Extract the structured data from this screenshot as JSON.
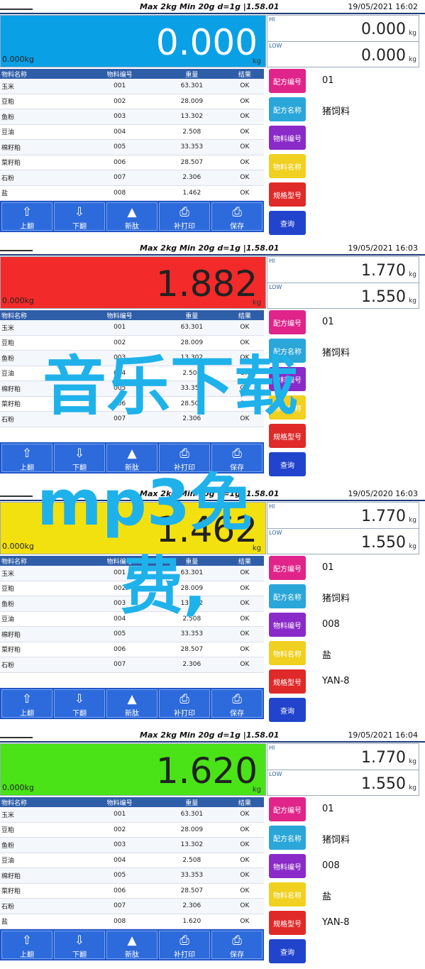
{
  "panels": [
    {
      "header": {
        "status": "Max 2kg  Min 20g  d=1g  |1.58.01",
        "datetime": "19/05/2021 16:02"
      },
      "display": {
        "weight": "0.000",
        "unit": "kg",
        "zero_label": "0.000kg",
        "color": "#0aa0e6",
        "light_text": true
      },
      "hilo": {
        "hi_label": "HI",
        "hi": "0.000",
        "lo_label": "LOW",
        "lo": "0.000",
        "unit": "kg"
      },
      "table": {
        "headers": [
          "物料名称",
          "物料编号",
          "重量",
          "结果"
        ],
        "rows": [
          [
            "玉米",
            "001",
            "63.301",
            "OK"
          ],
          [
            "豆粕",
            "002",
            "28.009",
            "OK"
          ],
          [
            "鱼粉",
            "003",
            "13.302",
            "OK"
          ],
          [
            "豆油",
            "004",
            "2.508",
            "OK"
          ],
          [
            "棉籽粕",
            "005",
            "33.353",
            "OK"
          ],
          [
            "菜籽粕",
            "006",
            "28.507",
            "OK"
          ],
          [
            "石粉",
            "007",
            "2.306",
            "OK"
          ],
          [
            "盐",
            "008",
            "1.462",
            "OK"
          ]
        ]
      },
      "side": [
        {
          "label": "配方编号",
          "value": "01"
        },
        {
          "label": "配方名称",
          "value": "猪饲料"
        },
        {
          "label": "物料编号",
          "value": ""
        },
        {
          "label": "物料名称",
          "value": ""
        },
        {
          "label": "规格型号",
          "value": ""
        },
        {
          "label": "查询",
          "value": ""
        }
      ],
      "bottom": [
        "上翻",
        "下翻",
        "新肽",
        "补打印",
        "保存"
      ]
    },
    {
      "header": {
        "status": "Max 2kg  Min 20g  d=1g  |1.58.01",
        "datetime": "19/05/2021 16:03"
      },
      "display": {
        "weight": "1.882",
        "unit": "kg",
        "zero_label": "0.000kg",
        "color": "#f22a2a",
        "light_text": false
      },
      "hilo": {
        "hi_label": "HI",
        "hi": "1.770",
        "lo_label": "LOW",
        "lo": "1.550",
        "unit": "kg"
      },
      "table": {
        "headers": [
          "物料名称",
          "物料编号",
          "重量",
          "结果"
        ],
        "rows": [
          [
            "玉米",
            "001",
            "63.301",
            "OK"
          ],
          [
            "豆粕",
            "002",
            "28.009",
            "OK"
          ],
          [
            "鱼粉",
            "003",
            "13.302",
            "OK"
          ],
          [
            "豆油",
            "004",
            "2.508",
            "OK"
          ],
          [
            "棉籽粕",
            "005",
            "33.353",
            "OK"
          ],
          [
            "菜籽粕",
            "006",
            "28.507",
            "OK"
          ],
          [
            "石粉",
            "007",
            "2.306",
            "OK"
          ]
        ]
      },
      "side": [
        {
          "label": "配方编号",
          "value": "01"
        },
        {
          "label": "配方名称",
          "value": "猪饲料"
        },
        {
          "label": "物料编号",
          "value": ""
        },
        {
          "label": "物料名称",
          "value": ""
        },
        {
          "label": "规格型号",
          "value": ""
        },
        {
          "label": "查询",
          "value": ""
        }
      ],
      "bottom": [
        "上翻",
        "下翻",
        "新肽",
        "补打印",
        "保存"
      ]
    },
    {
      "header": {
        "status": "Max 2kg  Min 20g  d=1g  |1.58.01",
        "datetime": "19/05/2020 16:03"
      },
      "display": {
        "weight": "1.462",
        "unit": "kg",
        "zero_label": "0.000kg",
        "color": "#f3e10f",
        "light_text": false
      },
      "hilo": {
        "hi_label": "HI",
        "hi": "1.770",
        "lo_label": "LOW",
        "lo": "1.550",
        "unit": "kg"
      },
      "table": {
        "headers": [
          "物料名称",
          "物料编号",
          "重量",
          "结果"
        ],
        "rows": [
          [
            "玉米",
            "001",
            "63.301",
            "OK"
          ],
          [
            "豆粕",
            "002",
            "28.009",
            "OK"
          ],
          [
            "鱼粉",
            "003",
            "13.302",
            "OK"
          ],
          [
            "豆油",
            "004",
            "2.508",
            "OK"
          ],
          [
            "棉籽粕",
            "005",
            "33.353",
            "OK"
          ],
          [
            "菜籽粕",
            "006",
            "28.507",
            "OK"
          ],
          [
            "石粉",
            "007",
            "2.306",
            "OK"
          ]
        ]
      },
      "side": [
        {
          "label": "配方编号",
          "value": "01"
        },
        {
          "label": "配方名称",
          "value": "猪饲料"
        },
        {
          "label": "物料编号",
          "value": "008"
        },
        {
          "label": "物料名称",
          "value": "盐"
        },
        {
          "label": "规格型号",
          "value": "YAN-8"
        },
        {
          "label": "查询",
          "value": ""
        }
      ],
      "bottom": [
        "上翻",
        "下翻",
        "新肽",
        "补打印",
        "保存"
      ]
    },
    {
      "header": {
        "status": "Max 2kg  Min 20g  d=1g  |1.58.01",
        "datetime": "19/05/2021 16:04"
      },
      "display": {
        "weight": "1.620",
        "unit": "kg",
        "zero_label": "0.000kg",
        "color": "#49e318",
        "light_text": false
      },
      "hilo": {
        "hi_label": "HI",
        "hi": "1.770",
        "lo_label": "LOW",
        "lo": "1.550",
        "unit": "kg"
      },
      "table": {
        "headers": [
          "物料名称",
          "物料编号",
          "重量",
          "结果"
        ],
        "rows": [
          [
            "玉米",
            "001",
            "63.301",
            "OK"
          ],
          [
            "豆粕",
            "002",
            "28.009",
            "OK"
          ],
          [
            "鱼粉",
            "003",
            "13.302",
            "OK"
          ],
          [
            "豆油",
            "004",
            "2.508",
            "OK"
          ],
          [
            "棉籽粕",
            "005",
            "33.353",
            "OK"
          ],
          [
            "菜籽粕",
            "006",
            "28.507",
            "OK"
          ],
          [
            "石粉",
            "007",
            "2.306",
            "OK"
          ],
          [
            "盐",
            "008",
            "1.620",
            "OK"
          ]
        ]
      },
      "side": [
        {
          "label": "配方编号",
          "value": "01"
        },
        {
          "label": "配方名称",
          "value": "猪饲料"
        },
        {
          "label": "物料编号",
          "value": "008"
        },
        {
          "label": "物料名称",
          "value": "盐"
        },
        {
          "label": "规格型号",
          "value": "YAN-8"
        },
        {
          "label": "查询",
          "value": ""
        }
      ],
      "bottom": [
        "上翻",
        "下翻",
        "新肽",
        "补打印",
        "保存"
      ]
    }
  ],
  "watermark": {
    "line1": "音乐下载",
    "line2": "mp3免",
    "line3": "费,"
  },
  "side_colors": [
    "#e0248a",
    "#2aa6d8",
    "#8a2ac8",
    "#f0d020",
    "#e02a2a",
    "#2244cc"
  ]
}
